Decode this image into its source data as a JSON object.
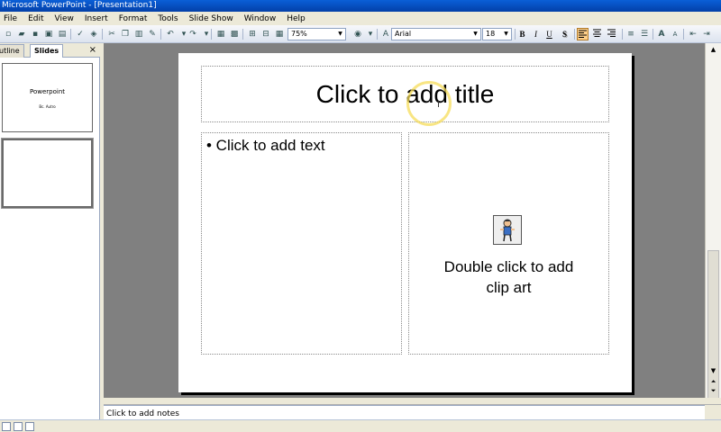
{
  "window": {
    "title": "Microsoft PowerPoint - [Presentation1]"
  },
  "menu": [
    "File",
    "Edit",
    "View",
    "Insert",
    "Format",
    "Tools",
    "Slide Show",
    "Window",
    "Help"
  ],
  "toolbar": {
    "zoom": "75%",
    "font": "Arial",
    "font_size": "18",
    "bold": "B",
    "italic": "I",
    "underline": "U",
    "shadow": "S"
  },
  "left_pane": {
    "tabs": [
      "utline",
      "Slides"
    ],
    "close": "×",
    "slide1": {
      "title": "Powerpoint",
      "subtitle": "Bc. Autro"
    }
  },
  "slide": {
    "title_placeholder": "Click to add title",
    "text_placeholder": "•  Click to add text",
    "clipart_line1": "Double click to add",
    "clipart_line2": "clip art"
  },
  "notes": {
    "placeholder": "Click to add notes"
  },
  "colors": {
    "titlebar": "#0A5FD8",
    "workspace": "#808080",
    "highlight_ring": "#F5DC5A"
  }
}
